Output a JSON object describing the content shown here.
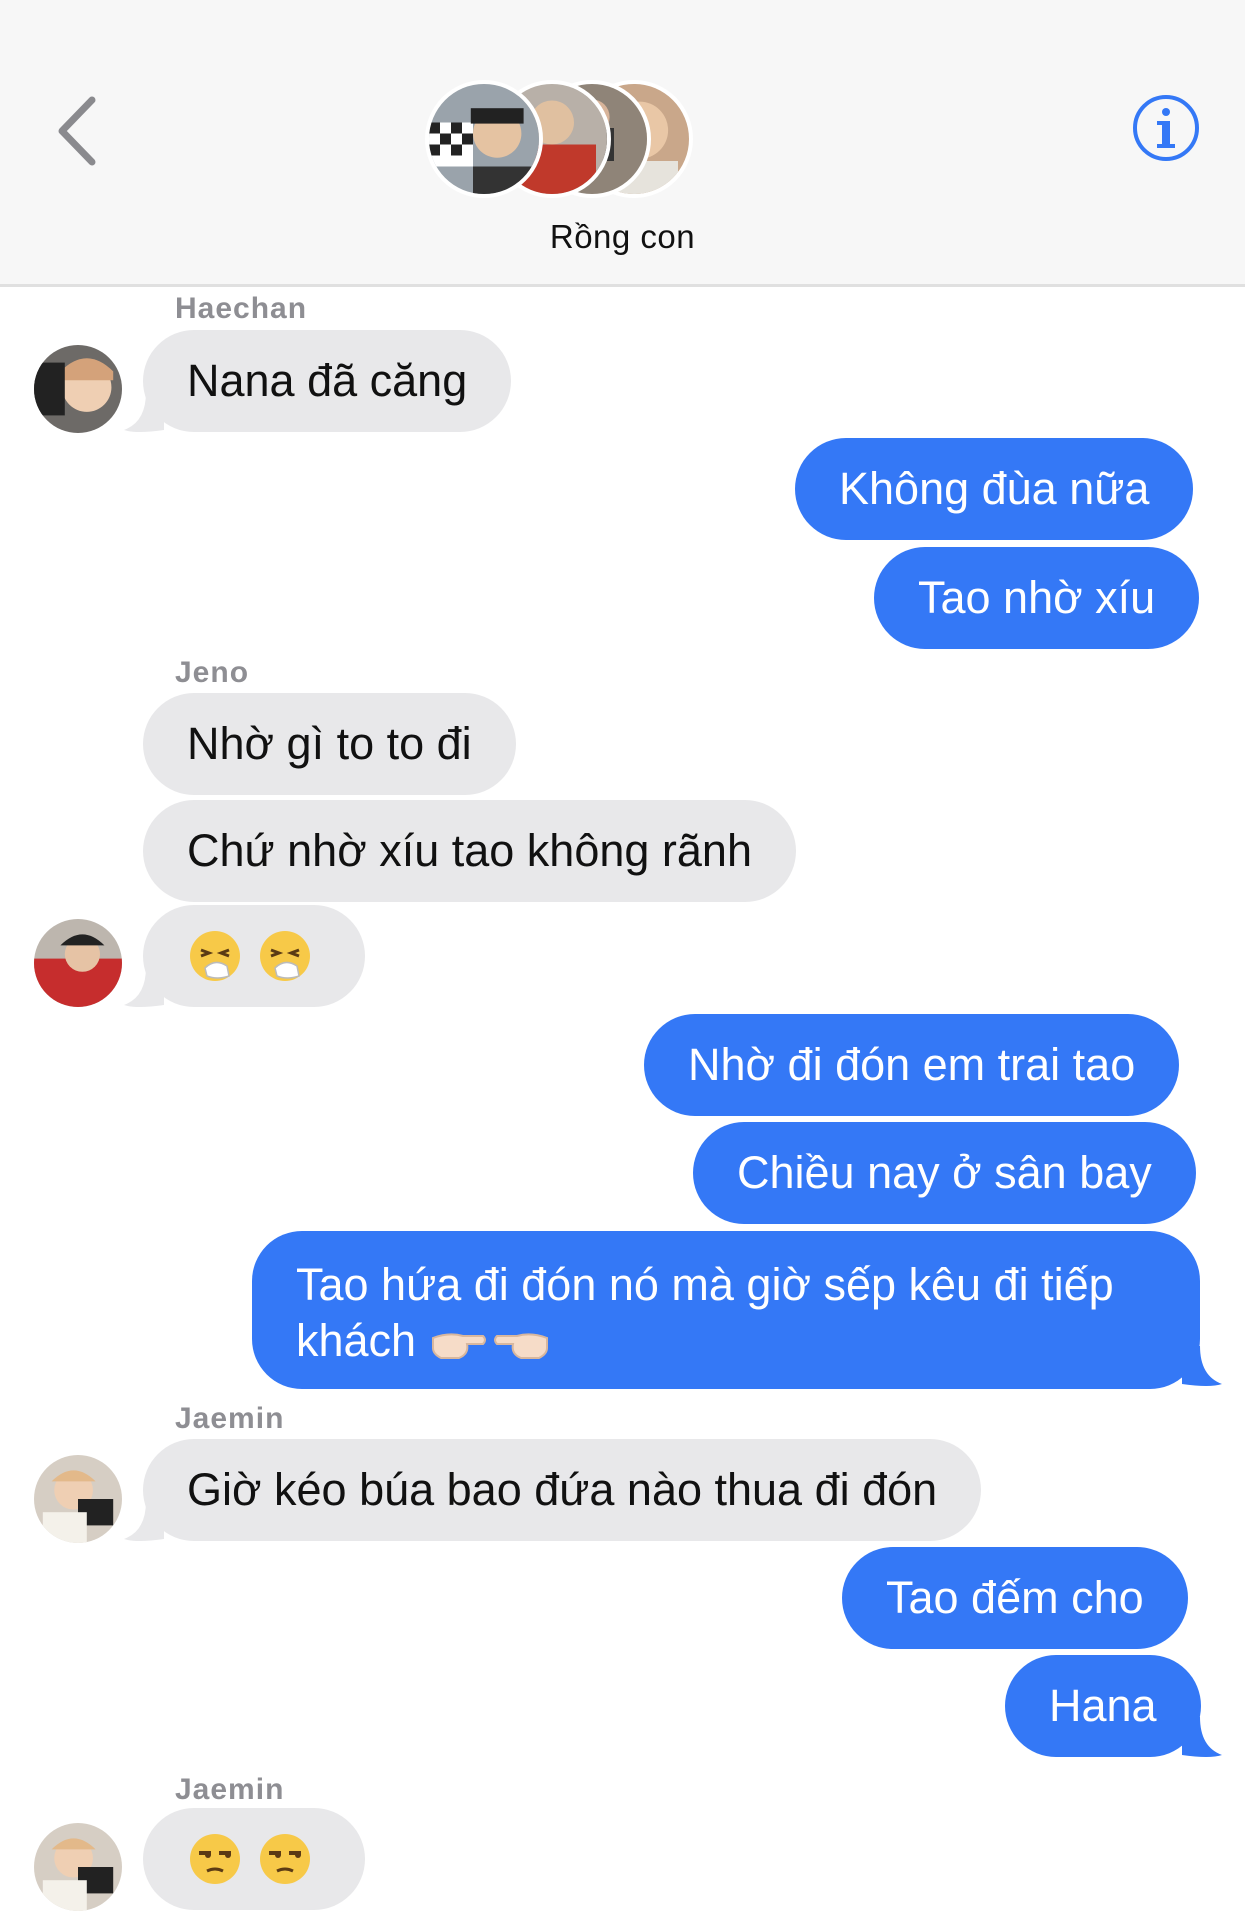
{
  "header": {
    "group_name": "Rồng con",
    "back_icon": "chevron-left-icon",
    "info_icon": "info-circle-icon"
  },
  "colors": {
    "outgoing_bubble": "#3478f6",
    "incoming_bubble": "#e8e8ea",
    "sender_label": "#8e8e93",
    "accent": "#3478f6"
  },
  "messages": [
    {
      "sender": "Haechan",
      "text": "Nana đã căng"
    },
    {
      "text": "Không đùa nữa"
    },
    {
      "text": "Tao nhờ xíu"
    },
    {
      "sender": "Jeno",
      "text": "Nhờ gì to to đi"
    },
    {
      "text": "Chứ nhờ xíu tao không rãnh"
    },
    {
      "emoji": "sneezing-face-emoji x2"
    },
    {
      "text": "Nhờ đi đón em trai tao"
    },
    {
      "text": "Chiều nay ở sân bay"
    },
    {
      "text": "Tao hứa đi đón nó mà giờ sếp kêu đi tiếp khách",
      "emoji": "pointing-hands-emoji"
    },
    {
      "sender": "Jaemin",
      "text": "Giờ kéo búa bao đứa nào thua đi đón"
    },
    {
      "text": "Tao đếm cho"
    },
    {
      "text": "Hana"
    },
    {
      "sender": "Jaemin",
      "emoji": "unamused-face-emoji x2"
    }
  ]
}
